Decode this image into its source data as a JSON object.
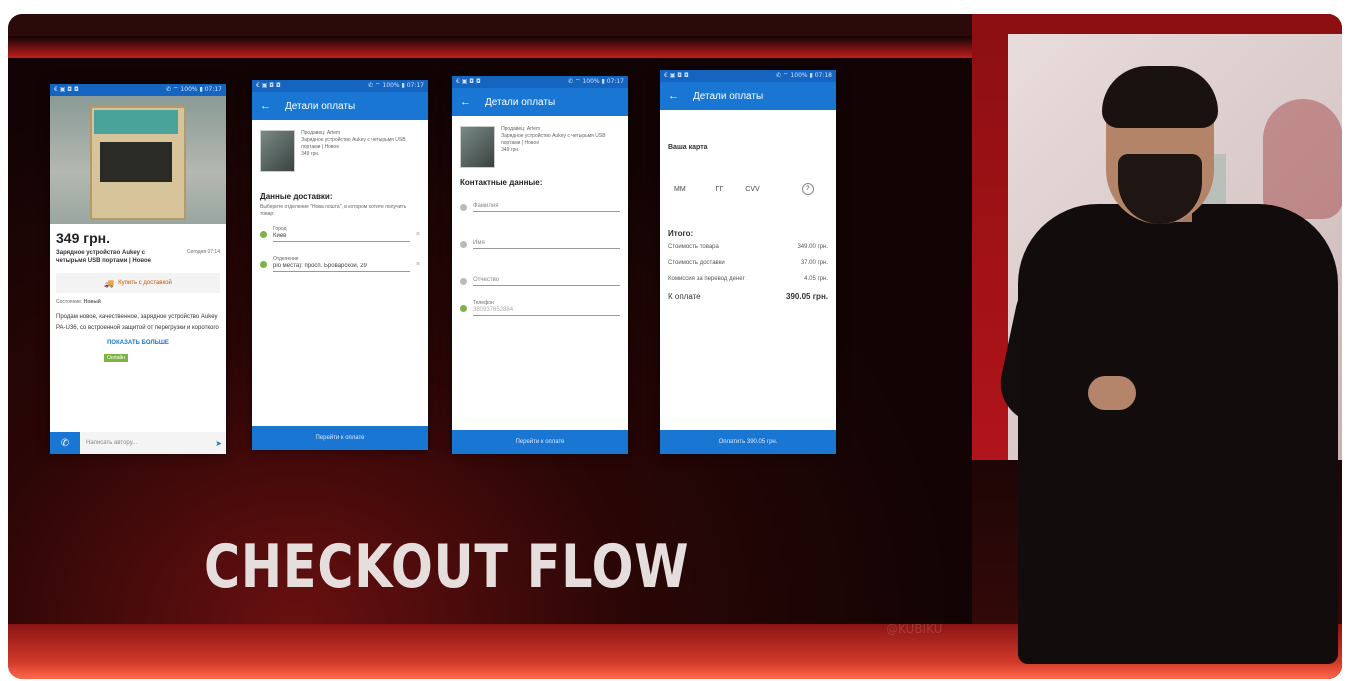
{
  "slide": {
    "headline": "CHECKOUT FLOW",
    "watermark": "@KUBIKU"
  },
  "phone1": {
    "status": "€ ▣ ◘ ◘",
    "status_right": "✆ ⌔ 100% ▮ 07:17",
    "price": "349 грн.",
    "title": "Зарядное устройство Aukey с четырьмя USB портами | Новое",
    "date": "Сегодня 07:14",
    "buy_button": "Купить с доставкой",
    "condition_label": "Состояние: ",
    "condition_value": "Новый",
    "description": "Продам новое, качественное, зарядное устройство Aukey PA-U36, со встроенной защитой от перегрузки и короткого",
    "show_more": "ПОКАЗАТЬ БОЛЬШЕ",
    "badge": "Онлайн",
    "message_placeholder": "Написать автору..."
  },
  "phone2": {
    "status": "€ ▣ ◘ ◘",
    "status_right": "✆ ⌔ 100% ▮ 07:17",
    "title": "Детали оплаты",
    "product_info": "Продавец: Artem\nЗарядное устройство Aukey с четырьмя USB портами | Новое\n349 грн.",
    "section": "Данные доставки:",
    "hint": "Выберите отделение \"Нова пошта\", в котором хотите получить товар:",
    "city_label": "Город",
    "city_value": "Киев",
    "branch_label": "Отделение",
    "branch_value": "ріо места): просп. Броварской, 29",
    "button": "Перейти к оплате"
  },
  "phone3": {
    "status": "€ ▣ ◘ ◘",
    "status_right": "✆ ⌔ 100% ▮ 07:17",
    "title": "Детали оплаты",
    "product_info": "Продавец: Artem\nЗарядное устройство Aukey с четырьмя USB портами | Новое\n349 грн.",
    "section": "Контактные данные:",
    "surname": "Фамилия",
    "name": "Имя",
    "patronymic": "Отчество",
    "phone_label": "Телефон",
    "phone_value": "380937652884",
    "button": "Перейти к оплате"
  },
  "phone4": {
    "status": "€ ▣ ◘ ◘",
    "status_right": "✆ ⌔ 100% ▮ 07:18",
    "title": "Детали оплаты",
    "card_label": "Ваша карта",
    "mm": "ММ",
    "yy": "ГГ",
    "cvv": "CVV",
    "help": "?",
    "total_label": "Итого:",
    "rows": [
      {
        "label": "Стоимость товара",
        "value": "349.00 грн."
      },
      {
        "label": "Стоимость доставки",
        "value": "37.00 грн."
      },
      {
        "label": "Комиссия за перевод денег",
        "value": "4.05 грн."
      }
    ],
    "pay_label": "К оплате",
    "pay_value": "390.05 грн.",
    "button": "Оплатить 390.05 грн."
  }
}
